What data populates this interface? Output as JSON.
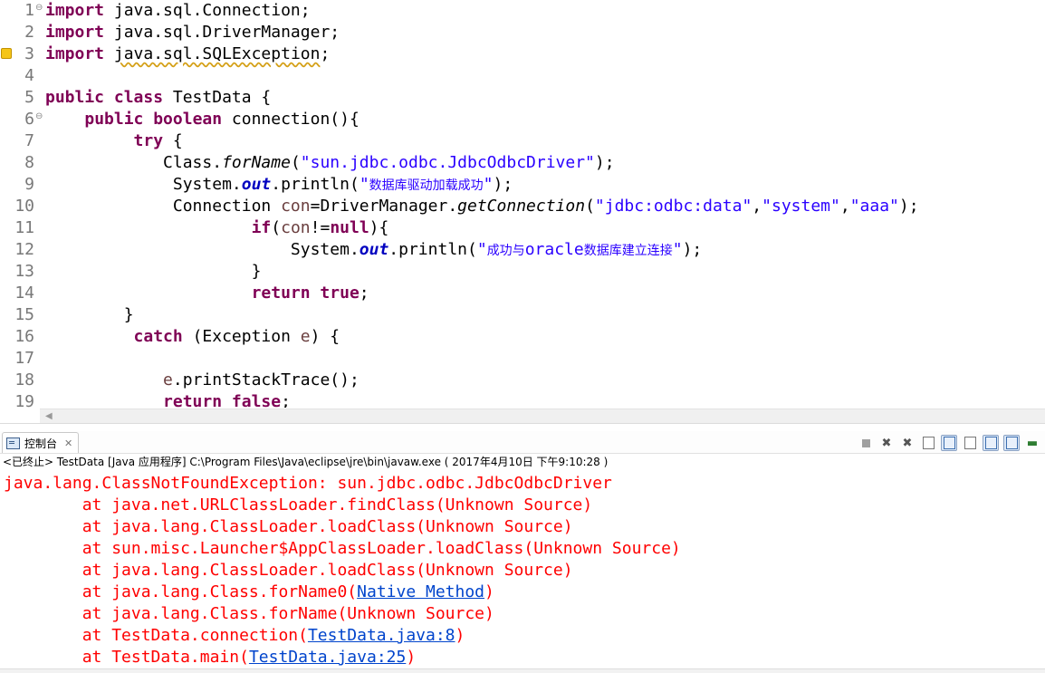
{
  "editor": {
    "lines": [
      {
        "n": "1",
        "fold": "⊖",
        "tokens": [
          {
            "t": "import",
            "c": "kw"
          },
          {
            "t": " java.sql.Connection;"
          }
        ]
      },
      {
        "n": "2",
        "tokens": [
          {
            "t": "import",
            "c": "kw"
          },
          {
            "t": " java.sql.DriverManager;"
          }
        ]
      },
      {
        "n": "3",
        "marker": true,
        "tokens": [
          {
            "t": "import",
            "c": "kw"
          },
          {
            "t": " "
          },
          {
            "t": "java.sql.SQLException",
            "c": "warn"
          },
          {
            "t": ";"
          }
        ]
      },
      {
        "n": "4",
        "tokens": []
      },
      {
        "n": "5",
        "tokens": [
          {
            "t": "public class",
            "c": "kw"
          },
          {
            "t": " TestData {"
          }
        ]
      },
      {
        "n": "6",
        "fold": "⊖",
        "tokens": [
          {
            "t": "    "
          },
          {
            "t": "public boolean",
            "c": "kw"
          },
          {
            "t": " connection(){"
          }
        ]
      },
      {
        "n": "7",
        "tokens": [
          {
            "t": "         "
          },
          {
            "t": "try",
            "c": "kw"
          },
          {
            "t": " {"
          }
        ]
      },
      {
        "n": "8",
        "tokens": [
          {
            "t": "            Class."
          },
          {
            "t": "forName",
            "c": "mth"
          },
          {
            "t": "("
          },
          {
            "t": "\"sun.jdbc.odbc.JdbcOdbcDriver\"",
            "c": "str"
          },
          {
            "t": ");"
          }
        ]
      },
      {
        "n": "9",
        "tokens": [
          {
            "t": "             System."
          },
          {
            "t": "out",
            "c": "fld"
          },
          {
            "t": ".println("
          },
          {
            "t": "\"",
            "c": "str"
          },
          {
            "t": "数据库驱动加载成功",
            "c": "str cjk"
          },
          {
            "t": "\"",
            "c": "str"
          },
          {
            "t": ");"
          }
        ]
      },
      {
        "n": "10",
        "tokens": [
          {
            "t": "             Connection "
          },
          {
            "t": "con",
            "c": "var"
          },
          {
            "t": "=DriverManager."
          },
          {
            "t": "getConnection",
            "c": "mth"
          },
          {
            "t": "("
          },
          {
            "t": "\"jdbc:odbc:data\"",
            "c": "str"
          },
          {
            "t": ","
          },
          {
            "t": "\"system\"",
            "c": "str"
          },
          {
            "t": ","
          },
          {
            "t": "\"aaa\"",
            "c": "str"
          },
          {
            "t": ");"
          }
        ]
      },
      {
        "n": "11",
        "tokens": [
          {
            "t": "                     "
          },
          {
            "t": "if",
            "c": "kw"
          },
          {
            "t": "("
          },
          {
            "t": "con",
            "c": "var"
          },
          {
            "t": "!="
          },
          {
            "t": "null",
            "c": "kw"
          },
          {
            "t": "){"
          }
        ]
      },
      {
        "n": "12",
        "tokens": [
          {
            "t": "                         System."
          },
          {
            "t": "out",
            "c": "fld"
          },
          {
            "t": ".println("
          },
          {
            "t": "\"",
            "c": "str"
          },
          {
            "t": "成功与",
            "c": "str cjk"
          },
          {
            "t": "oracle",
            "c": "str"
          },
          {
            "t": "数据库建立连接",
            "c": "str cjk"
          },
          {
            "t": "\"",
            "c": "str"
          },
          {
            "t": ");"
          }
        ]
      },
      {
        "n": "13",
        "tokens": [
          {
            "t": "                     }"
          }
        ]
      },
      {
        "n": "14",
        "tokens": [
          {
            "t": "                     "
          },
          {
            "t": "return true",
            "c": "kw"
          },
          {
            "t": ";"
          }
        ]
      },
      {
        "n": "15",
        "tokens": [
          {
            "t": "        }"
          }
        ]
      },
      {
        "n": "16",
        "tokens": [
          {
            "t": "         "
          },
          {
            "t": "catch",
            "c": "kw"
          },
          {
            "t": " (Exception "
          },
          {
            "t": "e",
            "c": "var"
          },
          {
            "t": ") {"
          }
        ]
      },
      {
        "n": "17",
        "tokens": []
      },
      {
        "n": "18",
        "tokens": [
          {
            "t": "            "
          },
          {
            "t": "e",
            "c": "var"
          },
          {
            "t": ".printStackTrace();"
          }
        ]
      },
      {
        "n": "19",
        "tokens": [
          {
            "t": "            "
          },
          {
            "t": "return false",
            "c": "kw"
          },
          {
            "t": ";"
          }
        ]
      }
    ]
  },
  "console": {
    "tab_label": "控制台",
    "tab_close": "✕",
    "status": "<已终止> TestData [Java 应用程序] C:\\Program Files\\Java\\eclipse\\jre\\bin\\javaw.exe ( 2017年4月10日 下午9:10:28 )",
    "output": [
      {
        "parts": [
          {
            "t": "java.lang.ClassNotFoundException: sun.jdbc.odbc.JdbcOdbcDriver"
          }
        ]
      },
      {
        "parts": [
          {
            "t": "\tat java.net.URLClassLoader.findClass(Unknown Source)"
          }
        ]
      },
      {
        "parts": [
          {
            "t": "\tat java.lang.ClassLoader.loadClass(Unknown Source)"
          }
        ]
      },
      {
        "parts": [
          {
            "t": "\tat sun.misc.Launcher$AppClassLoader.loadClass(Unknown Source)"
          }
        ]
      },
      {
        "parts": [
          {
            "t": "\tat java.lang.ClassLoader.loadClass(Unknown Source)"
          }
        ]
      },
      {
        "parts": [
          {
            "t": "\tat java.lang.Class.forName0("
          },
          {
            "t": "Native Method",
            "link": true
          },
          {
            "t": ")"
          }
        ]
      },
      {
        "parts": [
          {
            "t": "\tat java.lang.Class.forName(Unknown Source)"
          }
        ]
      },
      {
        "parts": [
          {
            "t": "\tat TestData.connection("
          },
          {
            "t": "TestData.java:8",
            "link": true
          },
          {
            "t": ")"
          }
        ]
      },
      {
        "parts": [
          {
            "t": "\tat TestData.main("
          },
          {
            "t": "TestData.java:25",
            "link": true
          },
          {
            "t": ")"
          }
        ]
      }
    ],
    "toolbar_icons": [
      "terminate-icon",
      "remove-launch-icon",
      "remove-all-launches-icon",
      "scroll-lock-icon",
      "word-wrap-icon",
      "show-on-output-icon",
      "show-on-error-icon",
      "pin-console-icon",
      "open-console-icon"
    ]
  },
  "colors": {
    "keyword": "#7f0055",
    "string": "#2a00ff",
    "field": "#0000c0",
    "error": "#ff0000",
    "link": "#0044cc"
  }
}
